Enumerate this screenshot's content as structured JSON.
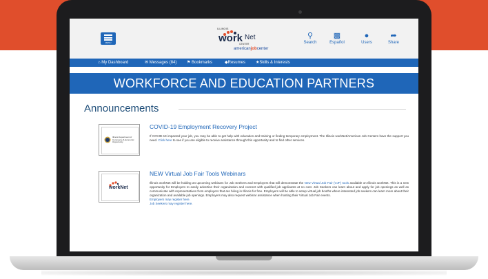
{
  "colors": {
    "brand_blue": "#1f66b8",
    "accent_orange": "#e04e2c",
    "heading_navy": "#1f4e79"
  },
  "header": {
    "menu_label": "MENU",
    "logo": {
      "illinois": "ILLINOIS",
      "name_bold": "work",
      "name_light": "Net",
      "center": "CENTER",
      "ajc_a": "american",
      "ajc_b": "job",
      "ajc_c": "center"
    },
    "icons": [
      {
        "name": "search-icon",
        "label": "Search"
      },
      {
        "name": "language-icon",
        "label": "Español"
      },
      {
        "name": "users-icon",
        "label": "Users"
      },
      {
        "name": "share-icon",
        "label": "Share"
      }
    ]
  },
  "nav": [
    {
      "icon": "home-icon",
      "label": "My Dashboard"
    },
    {
      "icon": "mail-icon",
      "label": "Messages (84)"
    },
    {
      "icon": "bookmark-icon",
      "label": "Bookmarks"
    },
    {
      "icon": "diamond-icon",
      "label": "Resumes"
    },
    {
      "icon": "star-icon",
      "label": "Skills & Interests"
    }
  ],
  "banner": "WORKFORCE AND EDUCATION PARTNERS",
  "section_title": "Announcements",
  "articles": [
    {
      "title": "COVID-19 Employment Recovery Project",
      "body_pre": "If COVID-19 impacted your job, you may be able to get help with education and training or finding temporary employment. The Illinois workNet/American Job Centers have the support you need. ",
      "link": "Click here",
      "body_post": " to see if you are eligible to receive assistance through this opportunity and to find other services.",
      "thumb_text": "Illinois Department of Commerce & Economic Opportunity"
    },
    {
      "title": "NEW Virtual Job Fair Tools Webinars",
      "body_pre": "Illinois workNet will be holding an upcoming webinars for Job Seekers and Employers that will demonstrate the ",
      "link": "New Virtual Job Fair (VJF) tools",
      "body_post": " available on Illinois workNet. This is a new opportunity for Employers to easily advertise their organization and connect with qualified job applicants at no cost. Job Seekers can learn about and apply for job openings as well as communicate with representatives from employers that are hiring in Illinois for free. Employers will be able to setup virtual job booths where interested job seekers can learn more about their organization and available job openings. Employers may also request webinar assistance when hosting their Virtual Job Fair events.",
      "link2": "Employers may register here.",
      "link3": "Job Seekers may register here.",
      "thumb_text": "workNet"
    }
  ]
}
